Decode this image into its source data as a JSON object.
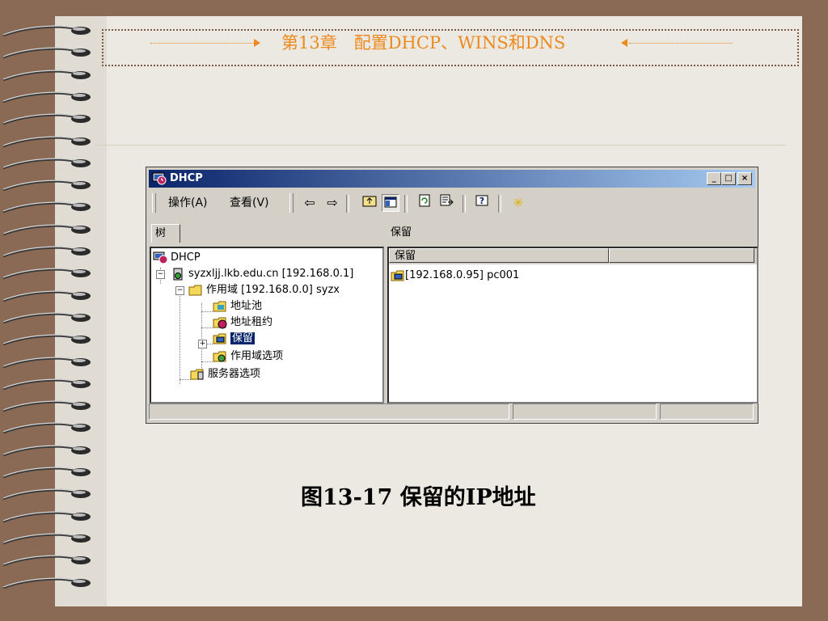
{
  "slide": {
    "header_title": "第13章　配置DHCP、WINS和DNS",
    "caption": "图13-17  保留的IP地址"
  },
  "window": {
    "title": "DHCP",
    "controls": {
      "minimize": "_",
      "maximize": "□",
      "close": "×"
    },
    "menu": {
      "action": "操作(A)",
      "view": "查看(V)"
    },
    "toolbar_icons": [
      "back-arrow-icon",
      "forward-arrow-icon",
      "up-folder-icon",
      "show-tree-icon",
      "refresh-icon",
      "export-list-icon",
      "help-icon",
      "new-star-icon"
    ],
    "tree_tab": "树",
    "right_tab": "保留",
    "tree": {
      "root": "DHCP",
      "server": "syzxljj.lkb.edu.cn [192.168.0.1]",
      "scope": "作用域 [192.168.0.0] syzx",
      "address_pool": "地址池",
      "address_leases": "地址租约",
      "reservations": "保留",
      "scope_options": "作用域选项",
      "server_options": "服务器选项"
    },
    "list": {
      "columns": [
        "保留",
        ""
      ],
      "rows": [
        "[192.168.0.95] pc001"
      ]
    }
  },
  "colors": {
    "accent": "#ec8a1e",
    "titlebar": "#0a246a",
    "selection": "#0a246a"
  }
}
